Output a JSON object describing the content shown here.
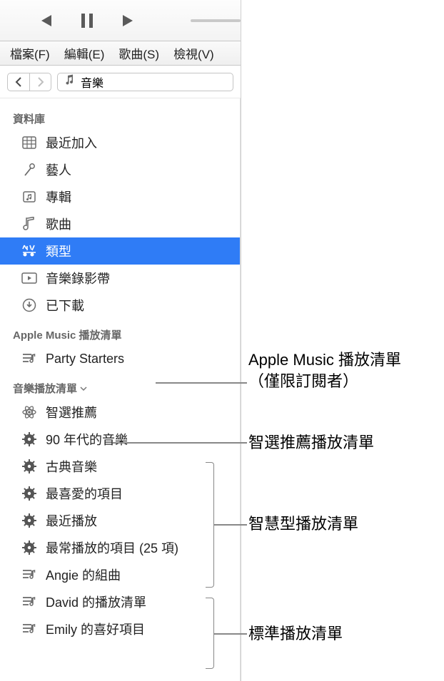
{
  "menubar": {
    "file": "檔案(F)",
    "edit": "編輯(E)",
    "song": "歌曲(S)",
    "view": "檢視(V)"
  },
  "chooser": {
    "label": "音樂"
  },
  "sections": {
    "library": {
      "header": "資料庫",
      "items": {
        "recently_added": "最近加入",
        "artists": "藝人",
        "albums": "專輯",
        "songs": "歌曲",
        "genres": "類型",
        "videos": "音樂錄影帶",
        "downloaded": "已下載"
      }
    },
    "apple_music": {
      "header": "Apple Music 播放清單",
      "items": {
        "party_starters": "Party Starters"
      }
    },
    "playlists": {
      "header": "音樂播放清單",
      "items": {
        "genius": "智選推薦",
        "smart_90s": "90 年代的音樂",
        "smart_classical": "古典音樂",
        "smart_favorites": "最喜愛的項目",
        "smart_recent": "最近播放",
        "smart_most_played": "最常播放的項目 (25 項)",
        "angie": "Angie 的組曲",
        "david": "David 的播放清單",
        "emily": "Emily 的喜好項目"
      }
    }
  },
  "annotations": {
    "apple_music": "Apple Music 播放清單\n（僅限訂閱者）",
    "genius": "智選推薦播放清單",
    "smart": "智慧型播放清單",
    "standard": "標準播放清單"
  }
}
